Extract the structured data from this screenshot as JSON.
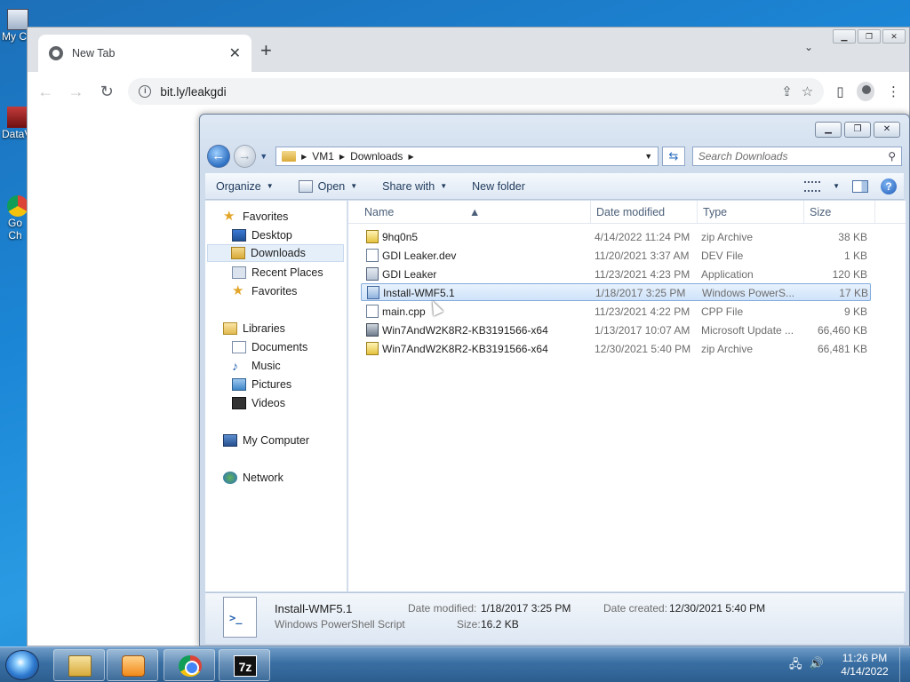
{
  "desktop": {
    "icons": [
      {
        "label": "My C"
      },
      {
        "label": "DataV"
      },
      {
        "label": "Go\nCh"
      }
    ]
  },
  "chrome": {
    "tab_title": "New Tab",
    "tab_close": "✕",
    "new_tab": "+",
    "tab_search": "⌄",
    "url": "bit.ly/leakgdi",
    "icons": [
      "back-arrow-icon",
      "forward-arrow-icon",
      "reload-icon",
      "site-info-icon",
      "share-icon",
      "star-icon",
      "side-panel-icon",
      "profile-icon",
      "menu-icon"
    ]
  },
  "explorer": {
    "breadcrumb": [
      "VM1",
      "Downloads"
    ],
    "search_placeholder": "Search Downloads",
    "commands": {
      "organize": "Organize",
      "open": "Open",
      "share_with": "Share with",
      "new_folder": "New folder"
    },
    "nav": {
      "favorites": "Favorites",
      "desktop": "Desktop",
      "downloads": "Downloads",
      "recent_places": "Recent Places",
      "favorites2": "Favorites",
      "libraries": "Libraries",
      "documents": "Documents",
      "music": "Music",
      "pictures": "Pictures",
      "videos": "Videos",
      "my_computer": "My Computer",
      "network": "Network"
    },
    "columns": {
      "name": "Name",
      "date_modified": "Date modified",
      "type": "Type",
      "size": "Size"
    },
    "files": [
      {
        "name": "9hq0n5",
        "date": "4/14/2022 11:24 PM",
        "type": "zip Archive",
        "size": "38 KB",
        "icon": "zip-icon",
        "selected": false
      },
      {
        "name": "GDI Leaker.dev",
        "date": "11/20/2021 3:37 AM",
        "type": "DEV File",
        "size": "1 KB",
        "icon": "file-icon",
        "selected": false
      },
      {
        "name": "GDI Leaker",
        "date": "11/23/2021 4:23 PM",
        "type": "Application",
        "size": "120 KB",
        "icon": "app-icon",
        "selected": false
      },
      {
        "name": "Install-WMF5.1",
        "date": "1/18/2017 3:25 PM",
        "type": "Windows PowerS...",
        "size": "17 KB",
        "icon": "powershell-icon",
        "selected": true
      },
      {
        "name": "main.cpp",
        "date": "11/23/2021 4:22 PM",
        "type": "CPP File",
        "size": "9 KB",
        "icon": "file-icon",
        "selected": false
      },
      {
        "name": "Win7AndW2K8R2-KB3191566-x64",
        "date": "1/13/2017 10:07 AM",
        "type": "Microsoft Update ...",
        "size": "66,460 KB",
        "icon": "msu-icon",
        "selected": false
      },
      {
        "name": "Win7AndW2K8R2-KB3191566-x64",
        "date": "12/30/2021 5:40 PM",
        "type": "zip Archive",
        "size": "66,481 KB",
        "icon": "zip-icon",
        "selected": false
      }
    ],
    "details": {
      "name": "Install-WMF5.1",
      "type": "Windows PowerShell Script",
      "date_modified_label": "Date modified:",
      "date_modified": "1/18/2017 3:25 PM",
      "date_created_label": "Date created:",
      "date_created": "12/30/2021 5:40 PM",
      "size_label": "Size:",
      "size": "16.2 KB"
    }
  },
  "taskbar": {
    "apps": [
      "windows-explorer",
      "media-player",
      "google-chrome",
      "7-zip"
    ],
    "seven_zip_label": "7z",
    "time": "11:26 PM",
    "date": "4/14/2022"
  }
}
